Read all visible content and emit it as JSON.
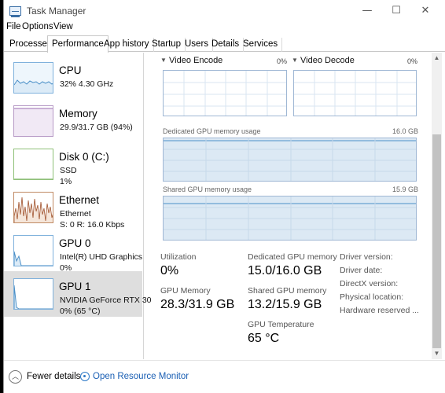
{
  "window": {
    "title": "Task Manager"
  },
  "menu": [
    "File",
    "Options",
    "View"
  ],
  "tabs": [
    "Processes",
    "Performance",
    "App history",
    "Startup",
    "Users",
    "Details",
    "Services"
  ],
  "active_tab": "Performance",
  "sidebar": [
    {
      "name": "CPU",
      "sub1": "32%  4.30 GHz",
      "sub2": "",
      "color": "#4a8fc7",
      "fill": "#dcebf7"
    },
    {
      "name": "Memory",
      "sub1": "29.9/31.7 GB (94%)",
      "sub2": "",
      "color": "#9b6bb2",
      "fill": "#f1e9f5"
    },
    {
      "name": "Disk 0 (C:)",
      "sub1": "SSD",
      "sub2": "1%",
      "color": "#69a84f",
      "fill": "#ffffff"
    },
    {
      "name": "Ethernet",
      "sub1": "Ethernet",
      "sub2": "S: 0  R: 16.0 Kbps",
      "color": "#a0522d",
      "fill": "#f5e6da"
    },
    {
      "name": "GPU 0",
      "sub1": "Intel(R) UHD Graphics",
      "sub2": "0%",
      "color": "#4a8fc7",
      "fill": "#ffffff"
    },
    {
      "name": "GPU 1",
      "sub1": "NVIDIA GeForce RTX 30",
      "sub2": "0%  (65 °C)",
      "color": "#4a8fc7",
      "fill": "#ffffff"
    }
  ],
  "selected_sidebar": "GPU 1",
  "main": {
    "video_encode": {
      "label": "Video Encode",
      "pct": "0%"
    },
    "video_decode": {
      "label": "Video Decode",
      "pct": "0%"
    },
    "dedicated_mem": {
      "label": "Dedicated GPU memory usage",
      "max": "16.0 GB"
    },
    "shared_mem": {
      "label": "Shared GPU memory usage",
      "max": "15.9 GB"
    },
    "stats": {
      "utilization": {
        "label": "Utilization",
        "value": "0%"
      },
      "dedicated": {
        "label": "Dedicated GPU memory",
        "value": "15.0/16.0 GB"
      },
      "gpu_memory": {
        "label": "GPU Memory",
        "value": "28.3/31.9 GB"
      },
      "shared": {
        "label": "Shared GPU memory",
        "value": "13.2/15.9 GB"
      },
      "temperature": {
        "label": "GPU Temperature",
        "value": "65 °C"
      }
    },
    "info_labels": [
      "Driver version:",
      "Driver date:",
      "DirectX version:",
      "Physical location:",
      "Hardware reserved ..."
    ]
  },
  "footer": {
    "fewer_details": "Fewer details",
    "resource_monitor": "Open Resource Monitor"
  },
  "colors": {
    "accent": "#1a5fb4",
    "graph_border": "#9fb7d4",
    "selected_bg": "#dedede"
  }
}
